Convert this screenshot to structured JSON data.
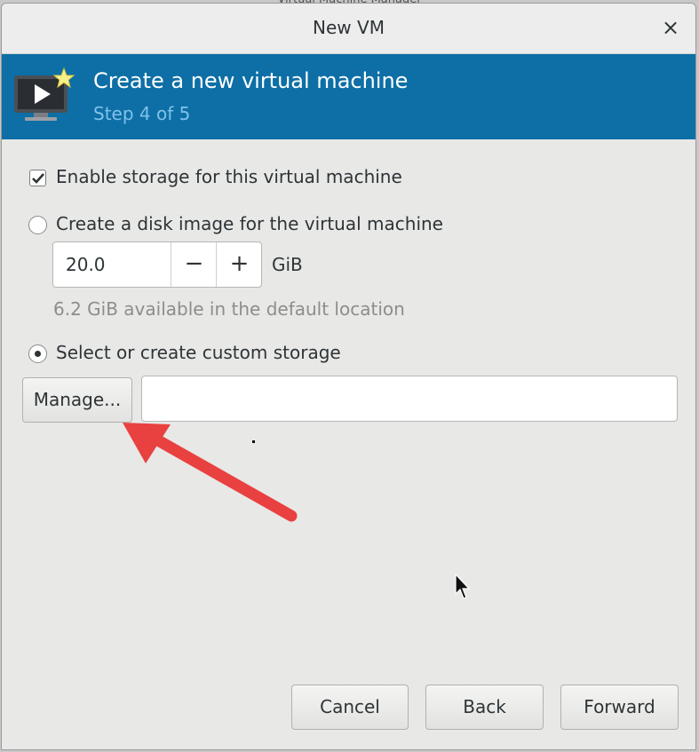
{
  "window": {
    "background_title": "Virtual Machine Manager",
    "title": "New VM",
    "close_glyph": "×"
  },
  "banner": {
    "heading": "Create a new virtual machine",
    "step": "Step 4 of 5",
    "icon": "vm-monitor-star-icon",
    "background_color": "#0d6fa6",
    "step_color": "#7fc2ea"
  },
  "storage": {
    "enable_label": "Enable storage for this virtual machine",
    "enable_checked": true,
    "create_disk_label": "Create a disk image for the virtual machine",
    "create_disk_selected": false,
    "disk_size_value": "20.0",
    "decrement_glyph": "−",
    "increment_glyph": "+",
    "unit": "GiB",
    "available_text": "6.2 GiB available in the default location",
    "custom_storage_label": "Select or create custom storage",
    "custom_storage_selected": true,
    "manage_button": "Manage...",
    "storage_path_value": ""
  },
  "footer": {
    "cancel": "Cancel",
    "back": "Back",
    "forward": "Forward"
  },
  "annotation": {
    "arrow_color": "#e8413f",
    "arrow_icon": "red-annotation-arrow"
  }
}
